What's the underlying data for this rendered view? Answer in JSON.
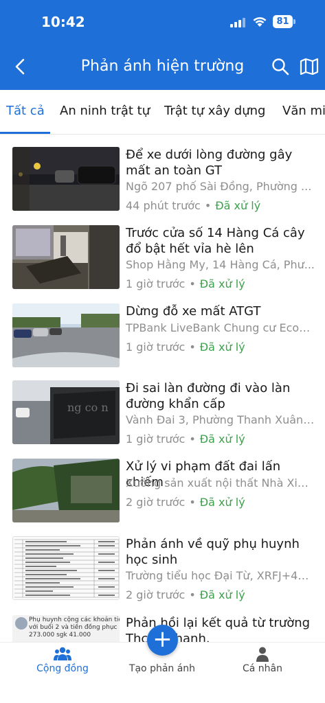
{
  "status_bar": {
    "time": "10:42",
    "battery": "81"
  },
  "header": {
    "title": "Phản ánh hiện trường",
    "back_icon": "chevron-left-icon",
    "search_icon": "search-icon",
    "map_icon": "map-icon"
  },
  "tabs": [
    {
      "label": "Tất cả",
      "active": true
    },
    {
      "label": "An ninh trật tự"
    },
    {
      "label": "Trật tự xây dựng"
    },
    {
      "label": "Văn mi"
    }
  ],
  "items": [
    {
      "title": "Để xe dưới lòng đường gây mất an toàn GT",
      "address": "Ngõ 207 phố Sài Đồng, Phường ...",
      "time": "44 phút trước",
      "status": "Đã xử lý"
    },
    {
      "title": "Trước cửa số 14 Hàng Cá cây đổ bật hết vỉa hè lên",
      "address": "Shop Hằng My, 14 Hàng Cá, Phư...",
      "time": "1 giờ trước",
      "status": "Đã xử lý"
    },
    {
      "title": "Dừng đỗ xe mất ATGT",
      "address": "TPBank LiveBank Chung cư Ecoh...",
      "time": "1 giờ trước",
      "status": "Đã xử lý"
    },
    {
      "title": "Đi sai làn đường đi vào làn đường khẩn cấp",
      "address": "Vành Đai 3, Phường Thanh Xuân,...",
      "time": "1 giờ trước",
      "status": "Đã xử lý"
    },
    {
      "title": "Xử lý vi phạm đất đai lấn chiếm",
      "address": "Xưởng sản xuất nội thất Nhà Xin...",
      "time": "2 giờ trước",
      "status": "Đã xử lý"
    },
    {
      "title": "Phản ánh về quỹ phụ huynh học sinh",
      "address": "Trường tiểu học Đại Từ, XRFJ+4R...",
      "time": "2 giờ trước",
      "status": "Đã xử lý"
    },
    {
      "title": "Phản hồi lại kết quả từ trường Thcs... thanh.",
      "thumb_text": [
        "Phụ huynh cộng các khoản tiền",
        "với buổi 2 và tiền đồng phục",
        "273.000 sgk 41.000"
      ]
    }
  ],
  "bottom_nav": [
    {
      "label": "Cộng đồng",
      "icon": "community-icon",
      "active": true
    },
    {
      "label": "Tạo phản ánh",
      "icon": "plus-icon"
    },
    {
      "label": "Cá nhân",
      "icon": "person-icon"
    }
  ],
  "colors": {
    "primary": "#1f6fd8",
    "status_done": "#3aa34a",
    "muted": "#8e8e8e"
  }
}
